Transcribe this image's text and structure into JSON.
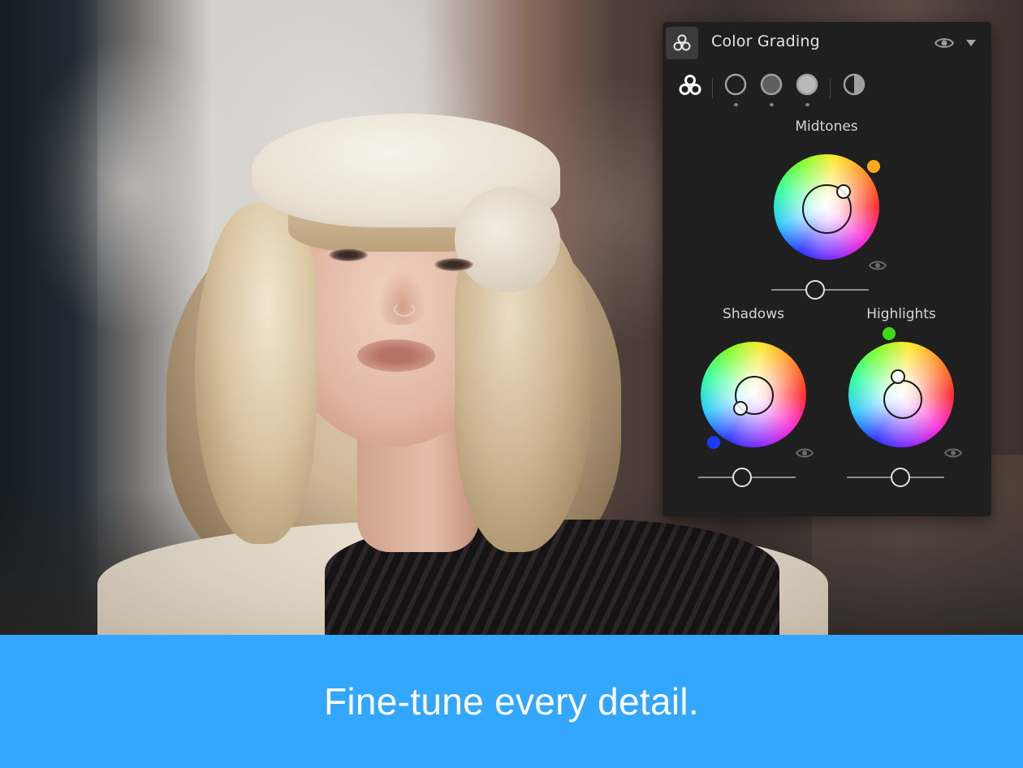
{
  "panel": {
    "title": "Color Grading",
    "header_icon": "color-grading-icon",
    "modes": [
      {
        "name": "three-way-mode",
        "icon": "three-circles-icon",
        "active": true
      },
      {
        "name": "shadows-mode",
        "icon": "dark-circle-icon",
        "active": false
      },
      {
        "name": "midtones-mode",
        "icon": "mid-circle-icon",
        "active": false
      },
      {
        "name": "highlights-mode",
        "icon": "light-circle-icon",
        "active": false
      },
      {
        "name": "global-mode",
        "icon": "half-circle-icon",
        "active": false
      }
    ],
    "wheels": {
      "midtones": {
        "label": "Midtones",
        "hue_color": "#ffaa1a",
        "slider_value": 0.45
      },
      "shadows": {
        "label": "Shadows",
        "hue_color": "#1a3bff",
        "slider_value": 0.45
      },
      "highlights": {
        "label": "Highlights",
        "hue_color": "#3ddc1a",
        "slider_value": 0.55
      }
    }
  },
  "caption": {
    "text": "Fine-tune every detail."
  },
  "colors": {
    "caption_bg": "#33a7fd",
    "panel_bg": "#1f1f1f"
  }
}
